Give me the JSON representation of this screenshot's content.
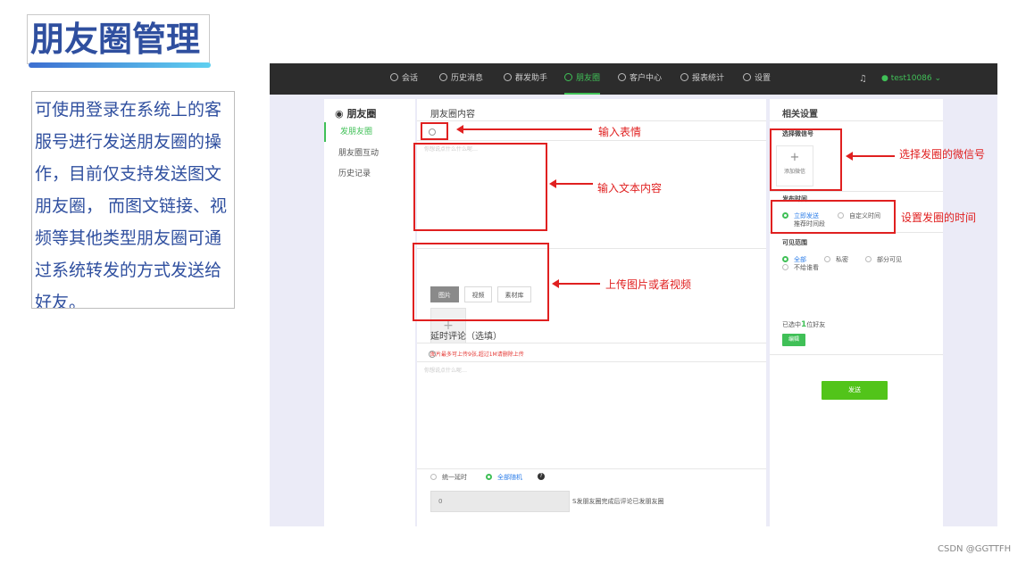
{
  "slide": {
    "title": "朋友圈管理",
    "description": "可使用登录在系统上的客服号进行发送朋友圈的操作，目前仅支持发送图文朋友圈， 而图文链接、视频等其他类型朋友圈可通过系统转发的方式发送给好友。",
    "watermark": "CSDN @GGTTFH"
  },
  "topbar": {
    "nav": [
      {
        "label": "会话",
        "icon": "chat-icon"
      },
      {
        "label": "历史消息",
        "icon": "clock-icon"
      },
      {
        "label": "群发助手",
        "icon": "send-icon"
      },
      {
        "label": "朋友圈",
        "icon": "moments-icon",
        "active": true
      },
      {
        "label": "客户中心",
        "icon": "user-icon"
      },
      {
        "label": "报表统计",
        "icon": "bar-chart-icon"
      },
      {
        "label": "设置",
        "icon": "gear-icon"
      }
    ],
    "bell_icon": "bell-icon",
    "username": "test10086"
  },
  "leftmenu": {
    "title": "朋友圈",
    "items": [
      {
        "label": "发朋友圈",
        "active": true
      },
      {
        "label": "朋友圈互动"
      },
      {
        "label": "历史记录"
      }
    ]
  },
  "center": {
    "content_title": "朋友圈内容",
    "text_placeholder": "你想说点什么什么呢…",
    "media_tabs": [
      {
        "label": "图片",
        "active": true
      },
      {
        "label": "视频"
      },
      {
        "label": "素材库"
      }
    ],
    "upload_plus": "+",
    "upload_hint": "图片最多可上传9张,超过1M请删除上传",
    "comment_title": "延时评论（选填）",
    "comment_placeholder": "你想说点什么呢…",
    "delay_options": [
      {
        "label": "统一延时"
      },
      {
        "label": "全部随机",
        "active": true
      }
    ],
    "help_mark": "?",
    "delay_value": "0",
    "delay_desc": "S发朋友圈完成后评论已发朋友圈"
  },
  "right": {
    "title": "相关设置",
    "account_label": "选择微信号",
    "add_plus": "+",
    "add_label": "添加微信",
    "time_label": "发布时间",
    "time_options": [
      {
        "label": "立即发送",
        "active": true
      },
      {
        "label": "自定义时间"
      },
      {
        "label": "推荐时间段"
      }
    ],
    "visible_label": "可见范围",
    "visible_options": [
      {
        "label": "全部",
        "active": true
      },
      {
        "label": "私密"
      },
      {
        "label": "部分可见"
      },
      {
        "label": "不给谁看"
      }
    ],
    "selected_prefix": "已选中",
    "selected_count": "1",
    "selected_suffix": "位好友",
    "edit_label": "编辑",
    "send_label": "发送"
  },
  "annotations": {
    "emoji": "输入表情",
    "text": "输入文本内容",
    "media": "上传图片或者视频",
    "account": "选择发圈的微信号",
    "time": "设置发圈的时间"
  },
  "colors": {
    "accent": "#40c057",
    "annotation": "#e02020",
    "title_blue": "#2f4f9f",
    "topbar": "#2c2c2c"
  }
}
